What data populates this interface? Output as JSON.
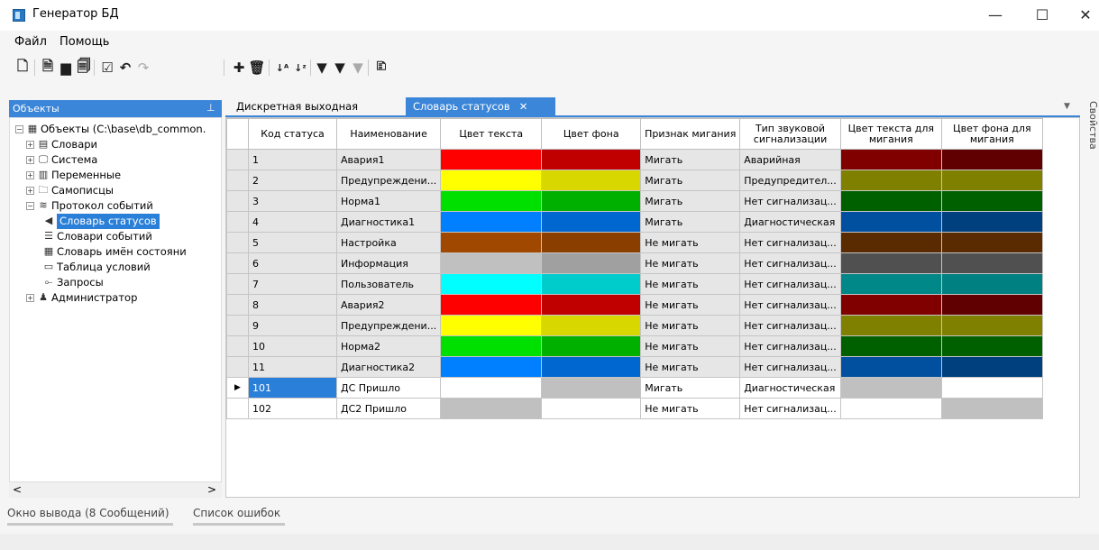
{
  "window": {
    "title": "Генератор БД",
    "minimize": "—",
    "maximize": "☐",
    "close": "✕"
  },
  "menu": [
    "Файл",
    "Помощь"
  ],
  "objects_panel": {
    "title": "Объекты",
    "pin": "📌",
    "tree": [
      {
        "label": "Объекты (C:\\base\\db_common.",
        "icon": "grid-icon",
        "level": 0,
        "expander": "−"
      },
      {
        "label": "Словари",
        "icon": "dictionary-icon",
        "level": 1,
        "expander": "+"
      },
      {
        "label": "Система",
        "icon": "monitor-icon",
        "level": 1,
        "expander": "+"
      },
      {
        "label": "Переменные",
        "icon": "table-icon",
        "level": 1,
        "expander": "+"
      },
      {
        "label": "Самописцы",
        "icon": "recorder-icon",
        "level": 1,
        "expander": "+"
      },
      {
        "label": "Протокол событий",
        "icon": "layers-icon",
        "level": 1,
        "expander": "−"
      },
      {
        "label": "Словарь статусов",
        "icon": "speaker-icon",
        "level": 2,
        "selected": true
      },
      {
        "label": "Словари событий",
        "icon": "list-icon",
        "level": 2
      },
      {
        "label": "Словарь имён состояни",
        "icon": "grid-small-icon",
        "level": 2
      },
      {
        "label": "Таблица условий",
        "icon": "table-conditions-icon",
        "level": 2
      },
      {
        "label": "Запросы",
        "icon": "query-icon",
        "level": 2
      },
      {
        "label": "Администратор",
        "icon": "user-icon",
        "level": 1,
        "expander": "+"
      }
    ],
    "scroll_left": "<",
    "scroll_right": ">"
  },
  "tabs": [
    {
      "label": "Дискретная выходная",
      "active": false
    },
    {
      "label": "Словарь статусов",
      "active": true,
      "close": "✕"
    }
  ],
  "side_panel": "Свойства",
  "grid": {
    "columns": [
      "Код статуса",
      "Наименование",
      "Цвет текста",
      "Цвет фона",
      "Признак мигания",
      "Тип звуковой сигнализации",
      "Цвет текста для мигания",
      "Цвет фона для мигания"
    ],
    "rows": [
      {
        "code": "1",
        "name": "Авария1",
        "text_color": "#ff0000",
        "bg_color": "#c00000",
        "blink": "Мигать",
        "sound": "Аварийная",
        "blink_text": "#800000",
        "blink_bg": "#600000"
      },
      {
        "code": "2",
        "name": "Предупреждени...",
        "text_color": "#ffff00",
        "bg_color": "#d8d800",
        "blink": "Мигать",
        "sound": "Предупредител...",
        "blink_text": "#808000",
        "blink_bg": "#808000"
      },
      {
        "code": "3",
        "name": "Норма1",
        "text_color": "#00e000",
        "bg_color": "#00b000",
        "blink": "Мигать",
        "sound": "Нет сигнализац...",
        "blink_text": "#006000",
        "blink_bg": "#006000"
      },
      {
        "code": "4",
        "name": "Диагностика1",
        "text_color": "#0080ff",
        "bg_color": "#0066d0",
        "blink": "Мигать",
        "sound": "Диагностическая",
        "blink_text": "#00509f",
        "blink_bg": "#00407f"
      },
      {
        "code": "5",
        "name": "Настройка",
        "text_color": "#a04800",
        "bg_color": "#8a3e00",
        "blink": "Не мигать",
        "sound": "Нет сигнализац...",
        "blink_text": "#5a2a00",
        "blink_bg": "#5a2a00"
      },
      {
        "code": "6",
        "name": "Информация",
        "text_color": "#c0c0c0",
        "bg_color": "#a0a0a0",
        "blink": "Не мигать",
        "sound": "Нет сигнализац...",
        "blink_text": "#505050",
        "blink_bg": "#505050"
      },
      {
        "code": "7",
        "name": "Пользователь",
        "text_color": "#00ffff",
        "bg_color": "#00cccc",
        "blink": "Не мигать",
        "sound": "Нет сигнализац...",
        "blink_text": "#008888",
        "blink_bg": "#008080"
      },
      {
        "code": "8",
        "name": "Авария2",
        "text_color": "#ff0000",
        "bg_color": "#c00000",
        "blink": "Не мигать",
        "sound": "Нет сигнализац...",
        "blink_text": "#800000",
        "blink_bg": "#600000"
      },
      {
        "code": "9",
        "name": "Предупреждени...",
        "text_color": "#ffff00",
        "bg_color": "#d8d800",
        "blink": "Не мигать",
        "sound": "Нет сигнализац...",
        "blink_text": "#808000",
        "blink_bg": "#808000"
      },
      {
        "code": "10",
        "name": "Норма2",
        "text_color": "#00e000",
        "bg_color": "#00b000",
        "blink": "Не мигать",
        "sound": "Нет сигнализац...",
        "blink_text": "#006000",
        "blink_bg": "#006000"
      },
      {
        "code": "11",
        "name": "Диагностика2",
        "text_color": "#0080ff",
        "bg_color": "#0066d0",
        "blink": "Не мигать",
        "sound": "Нет сигнализац...",
        "blink_text": "#00509f",
        "blink_bg": "#00407f"
      },
      {
        "code": "101",
        "name": "ДС Пришло",
        "text_color": "#ffffff",
        "bg_color": "#c0c0c0",
        "blink": "Мигать",
        "sound": "Диагностическая",
        "blink_text": "#c0c0c0",
        "blink_bg": "#ffffff",
        "current": true
      },
      {
        "code": "102",
        "name": "ДС2 Пришло",
        "text_color": "#c0c0c0",
        "bg_color": "#ffffff",
        "blink": "Не мигать",
        "sound": "Нет сигнализац...",
        "blink_text": "#ffffff",
        "blink_bg": "#c0c0c0"
      }
    ],
    "current_row_marker": "▶"
  },
  "bottom_tabs": [
    "Окно вывода (8 Сообщений)",
    "Список ошибок"
  ],
  "toolbar_icons": [
    "new-file-icon",
    "open-file-icon",
    "save-icon",
    "save-as-icon",
    "validate-icon",
    "undo-icon",
    "redo-icon",
    "add-icon",
    "delete-icon",
    "sort-asc-icon",
    "sort-desc-icon",
    "filter-icon",
    "filter-add-icon",
    "filter-clear-icon",
    "export-icon"
  ],
  "accent_color": "#3b86d9"
}
